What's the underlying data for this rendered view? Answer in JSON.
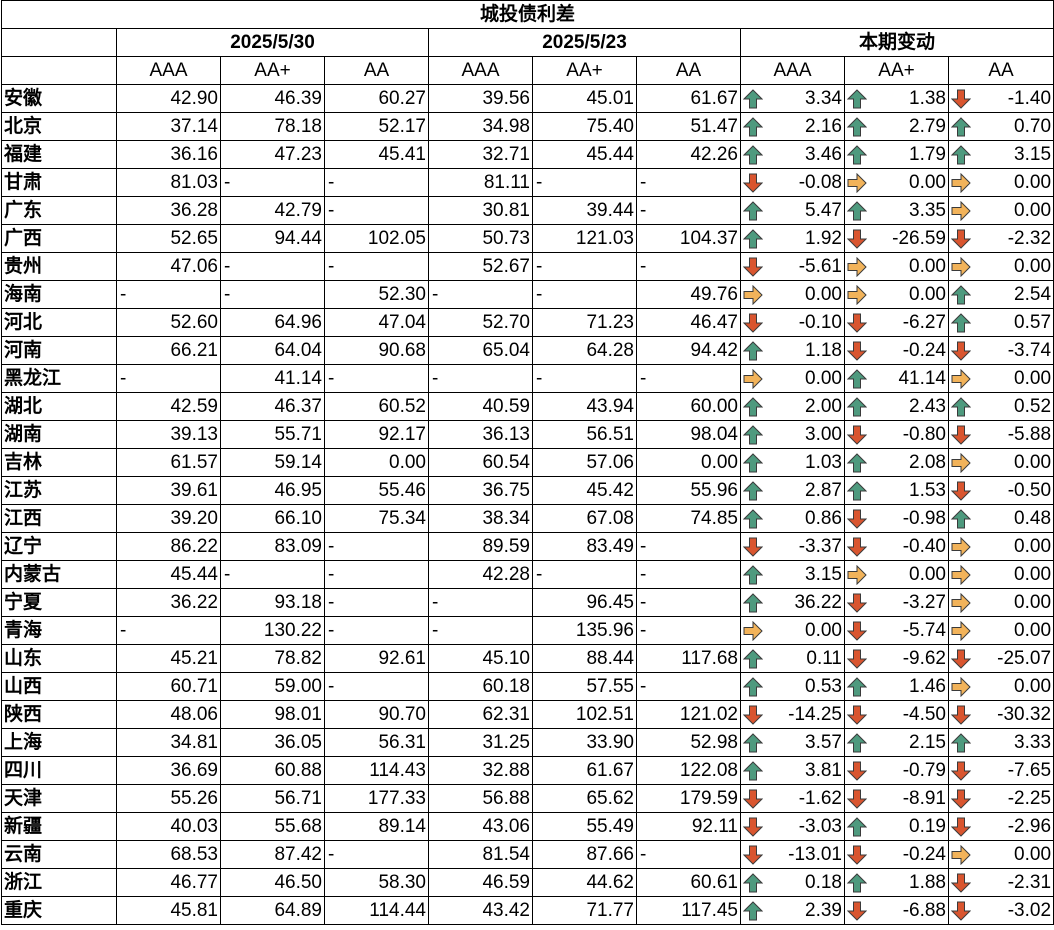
{
  "title": "城投债利差",
  "groups": [
    "2025/5/30",
    "2025/5/23",
    "本期变动"
  ],
  "grades": [
    "AAA",
    "AA+",
    "AA"
  ],
  "arrow_colors": {
    "up": "#4e9a7e",
    "down": "#d9552f",
    "flat": "#f2b35a"
  },
  "rows": [
    {
      "p": "安徽",
      "c": [
        "42.90",
        "46.39",
        "60.27"
      ],
      "l": [
        "39.56",
        "45.01",
        "61.67"
      ],
      "d": [
        "3.34",
        "1.38",
        "-1.40"
      ],
      "a": [
        "up",
        "up",
        "down"
      ]
    },
    {
      "p": "北京",
      "c": [
        "37.14",
        "78.18",
        "52.17"
      ],
      "l": [
        "34.98",
        "75.40",
        "51.47"
      ],
      "d": [
        "2.16",
        "2.79",
        "0.70"
      ],
      "a": [
        "up",
        "up",
        "up"
      ]
    },
    {
      "p": "福建",
      "c": [
        "36.16",
        "47.23",
        "45.41"
      ],
      "l": [
        "32.71",
        "45.44",
        "42.26"
      ],
      "d": [
        "3.46",
        "1.79",
        "3.15"
      ],
      "a": [
        "up",
        "up",
        "up"
      ]
    },
    {
      "p": "甘肃",
      "c": [
        "81.03",
        "-",
        "-"
      ],
      "l": [
        "81.11",
        "-",
        "-"
      ],
      "d": [
        "-0.08",
        "0.00",
        "0.00"
      ],
      "a": [
        "down",
        "flat",
        "flat"
      ]
    },
    {
      "p": "广东",
      "c": [
        "36.28",
        "42.79",
        "-"
      ],
      "l": [
        "30.81",
        "39.44",
        "-"
      ],
      "d": [
        "5.47",
        "3.35",
        "0.00"
      ],
      "a": [
        "up",
        "up",
        "flat"
      ]
    },
    {
      "p": "广西",
      "c": [
        "52.65",
        "94.44",
        "102.05"
      ],
      "l": [
        "50.73",
        "121.03",
        "104.37"
      ],
      "d": [
        "1.92",
        "-26.59",
        "-2.32"
      ],
      "a": [
        "up",
        "down",
        "down"
      ]
    },
    {
      "p": "贵州",
      "c": [
        "47.06",
        "-",
        "-"
      ],
      "l": [
        "52.67",
        "-",
        "-"
      ],
      "d": [
        "-5.61",
        "0.00",
        "0.00"
      ],
      "a": [
        "down",
        "flat",
        "flat"
      ]
    },
    {
      "p": "海南",
      "c": [
        "-",
        "-",
        "52.30"
      ],
      "l": [
        "-",
        "-",
        "49.76"
      ],
      "d": [
        "0.00",
        "0.00",
        "2.54"
      ],
      "a": [
        "flat",
        "flat",
        "up"
      ]
    },
    {
      "p": "河北",
      "c": [
        "52.60",
        "64.96",
        "47.04"
      ],
      "l": [
        "52.70",
        "71.23",
        "46.47"
      ],
      "d": [
        "-0.10",
        "-6.27",
        "0.57"
      ],
      "a": [
        "down",
        "down",
        "up"
      ]
    },
    {
      "p": "河南",
      "c": [
        "66.21",
        "64.04",
        "90.68"
      ],
      "l": [
        "65.04",
        "64.28",
        "94.42"
      ],
      "d": [
        "1.18",
        "-0.24",
        "-3.74"
      ],
      "a": [
        "up",
        "down",
        "down"
      ]
    },
    {
      "p": "黑龙江",
      "c": [
        "-",
        "41.14",
        "-"
      ],
      "l": [
        "-",
        "-",
        "-"
      ],
      "d": [
        "0.00",
        "41.14",
        "0.00"
      ],
      "a": [
        "flat",
        "up",
        "flat"
      ]
    },
    {
      "p": "湖北",
      "c": [
        "42.59",
        "46.37",
        "60.52"
      ],
      "l": [
        "40.59",
        "43.94",
        "60.00"
      ],
      "d": [
        "2.00",
        "2.43",
        "0.52"
      ],
      "a": [
        "up",
        "up",
        "up"
      ]
    },
    {
      "p": "湖南",
      "c": [
        "39.13",
        "55.71",
        "92.17"
      ],
      "l": [
        "36.13",
        "56.51",
        "98.04"
      ],
      "d": [
        "3.00",
        "-0.80",
        "-5.88"
      ],
      "a": [
        "up",
        "down",
        "down"
      ]
    },
    {
      "p": "吉林",
      "c": [
        "61.57",
        "59.14",
        "0.00"
      ],
      "l": [
        "60.54",
        "57.06",
        "0.00"
      ],
      "d": [
        "1.03",
        "2.08",
        "0.00"
      ],
      "a": [
        "up",
        "up",
        "flat"
      ]
    },
    {
      "p": "江苏",
      "c": [
        "39.61",
        "46.95",
        "55.46"
      ],
      "l": [
        "36.75",
        "45.42",
        "55.96"
      ],
      "d": [
        "2.87",
        "1.53",
        "-0.50"
      ],
      "a": [
        "up",
        "up",
        "down"
      ]
    },
    {
      "p": "江西",
      "c": [
        "39.20",
        "66.10",
        "75.34"
      ],
      "l": [
        "38.34",
        "67.08",
        "74.85"
      ],
      "d": [
        "0.86",
        "-0.98",
        "0.48"
      ],
      "a": [
        "up",
        "down",
        "up"
      ]
    },
    {
      "p": "辽宁",
      "c": [
        "86.22",
        "83.09",
        "-"
      ],
      "l": [
        "89.59",
        "83.49",
        "-"
      ],
      "d": [
        "-3.37",
        "-0.40",
        "0.00"
      ],
      "a": [
        "down",
        "down",
        "flat"
      ]
    },
    {
      "p": "内蒙古",
      "c": [
        "45.44",
        "-",
        "-"
      ],
      "l": [
        "42.28",
        "-",
        "-"
      ],
      "d": [
        "3.15",
        "0.00",
        "0.00"
      ],
      "a": [
        "up",
        "flat",
        "flat"
      ]
    },
    {
      "p": "宁夏",
      "c": [
        "36.22",
        "93.18",
        "-"
      ],
      "l": [
        "-",
        "96.45",
        "-"
      ],
      "d": [
        "36.22",
        "-3.27",
        "0.00"
      ],
      "a": [
        "up",
        "down",
        "flat"
      ]
    },
    {
      "p": "青海",
      "c": [
        "-",
        "130.22",
        "-"
      ],
      "l": [
        "-",
        "135.96",
        "-"
      ],
      "d": [
        "0.00",
        "-5.74",
        "0.00"
      ],
      "a": [
        "flat",
        "down",
        "flat"
      ]
    },
    {
      "p": "山东",
      "c": [
        "45.21",
        "78.82",
        "92.61"
      ],
      "l": [
        "45.10",
        "88.44",
        "117.68"
      ],
      "d": [
        "0.11",
        "-9.62",
        "-25.07"
      ],
      "a": [
        "up",
        "down",
        "down"
      ]
    },
    {
      "p": "山西",
      "c": [
        "60.71",
        "59.00",
        "-"
      ],
      "l": [
        "60.18",
        "57.55",
        "-"
      ],
      "d": [
        "0.53",
        "1.46",
        "0.00"
      ],
      "a": [
        "up",
        "up",
        "flat"
      ]
    },
    {
      "p": "陕西",
      "c": [
        "48.06",
        "98.01",
        "90.70"
      ],
      "l": [
        "62.31",
        "102.51",
        "121.02"
      ],
      "d": [
        "-14.25",
        "-4.50",
        "-30.32"
      ],
      "a": [
        "down",
        "down",
        "down"
      ]
    },
    {
      "p": "上海",
      "c": [
        "34.81",
        "36.05",
        "56.31"
      ],
      "l": [
        "31.25",
        "33.90",
        "52.98"
      ],
      "d": [
        "3.57",
        "2.15",
        "3.33"
      ],
      "a": [
        "up",
        "up",
        "up"
      ]
    },
    {
      "p": "四川",
      "c": [
        "36.69",
        "60.88",
        "114.43"
      ],
      "l": [
        "32.88",
        "61.67",
        "122.08"
      ],
      "d": [
        "3.81",
        "-0.79",
        "-7.65"
      ],
      "a": [
        "up",
        "down",
        "down"
      ]
    },
    {
      "p": "天津",
      "c": [
        "55.26",
        "56.71",
        "177.33"
      ],
      "l": [
        "56.88",
        "65.62",
        "179.59"
      ],
      "d": [
        "-1.62",
        "-8.91",
        "-2.25"
      ],
      "a": [
        "down",
        "down",
        "down"
      ]
    },
    {
      "p": "新疆",
      "c": [
        "40.03",
        "55.68",
        "89.14"
      ],
      "l": [
        "43.06",
        "55.49",
        "92.11"
      ],
      "d": [
        "-3.03",
        "0.19",
        "-2.96"
      ],
      "a": [
        "down",
        "up",
        "down"
      ]
    },
    {
      "p": "云南",
      "c": [
        "68.53",
        "87.42",
        "-"
      ],
      "l": [
        "81.54",
        "87.66",
        "-"
      ],
      "d": [
        "-13.01",
        "-0.24",
        "0.00"
      ],
      "a": [
        "down",
        "down",
        "flat"
      ]
    },
    {
      "p": "浙江",
      "c": [
        "46.77",
        "46.50",
        "58.30"
      ],
      "l": [
        "46.59",
        "44.62",
        "60.61"
      ],
      "d": [
        "0.18",
        "1.88",
        "-2.31"
      ],
      "a": [
        "up",
        "up",
        "down"
      ]
    },
    {
      "p": "重庆",
      "c": [
        "45.81",
        "64.89",
        "114.44"
      ],
      "l": [
        "43.42",
        "71.77",
        "117.45"
      ],
      "d": [
        "2.39",
        "-6.88",
        "-3.02"
      ],
      "a": [
        "up",
        "down",
        "down"
      ]
    }
  ]
}
